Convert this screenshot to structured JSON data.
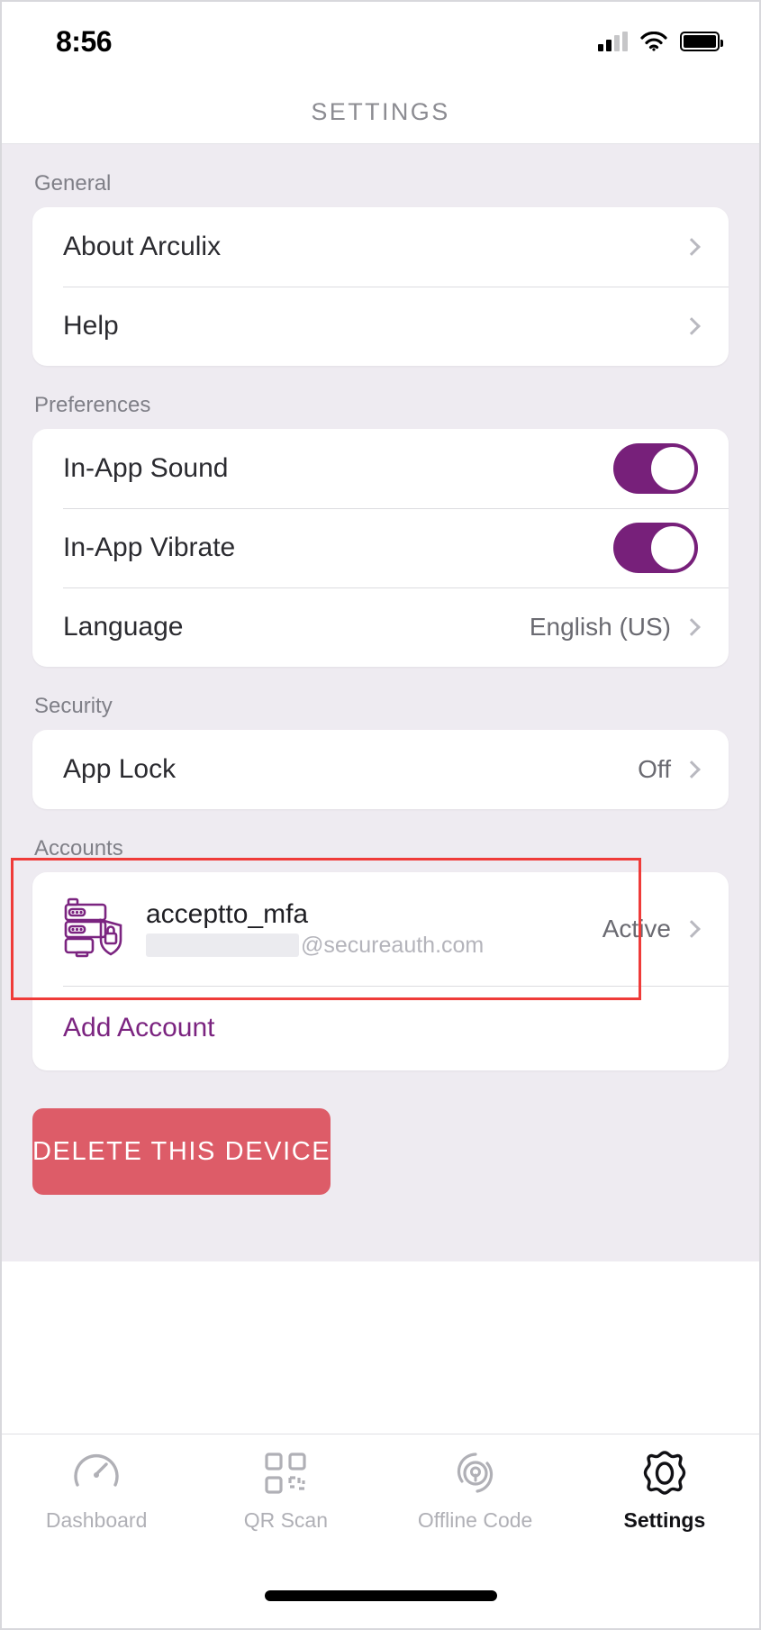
{
  "status_bar": {
    "time": "8:56",
    "signal_icon": "cellular-signal-icon",
    "wifi_icon": "wifi-icon",
    "battery_icon": "battery-icon"
  },
  "header": {
    "title": "SETTINGS"
  },
  "colors": {
    "accent_purple": "#77207A",
    "danger_red": "#DD5C68",
    "highlight_red": "#EF3B39",
    "page_background": "#EEEBF1",
    "card_background": "#FFFFFF",
    "label_gray": "#7F7F87"
  },
  "sections": {
    "general": {
      "label": "General",
      "rows": [
        {
          "label": "About Arculix",
          "value": "",
          "chevron": true
        },
        {
          "label": "Help",
          "value": "",
          "chevron": true
        }
      ]
    },
    "preferences": {
      "label": "Preferences",
      "rows": [
        {
          "label": "In-App Sound",
          "control": "toggle",
          "state": "on"
        },
        {
          "label": "In-App Vibrate",
          "control": "toggle",
          "state": "on"
        },
        {
          "label": "Language",
          "value": "English (US)",
          "chevron": true
        }
      ]
    },
    "security": {
      "label": "Security",
      "highlighted": true,
      "rows": [
        {
          "label": "App Lock",
          "value": "Off",
          "chevron": true
        }
      ]
    },
    "accounts": {
      "label": "Accounts",
      "items": [
        {
          "icon": "server-lock-icon",
          "name": "acceptto_mfa",
          "email_redacted": true,
          "email_domain": "@secureauth.com",
          "status": "Active",
          "chevron": true
        }
      ],
      "add_account_label": "Add Account"
    }
  },
  "delete_button": {
    "label": "DELETE THIS DEVICE"
  },
  "tabbar": {
    "tabs": [
      {
        "label": "Dashboard",
        "icon": "speedometer-icon",
        "active": false
      },
      {
        "label": "QR Scan",
        "icon": "qr-code-icon",
        "active": false
      },
      {
        "label": "Offline Code",
        "icon": "location-pin-icon",
        "active": false
      },
      {
        "label": "Settings",
        "icon": "gear-icon",
        "active": true
      }
    ]
  }
}
